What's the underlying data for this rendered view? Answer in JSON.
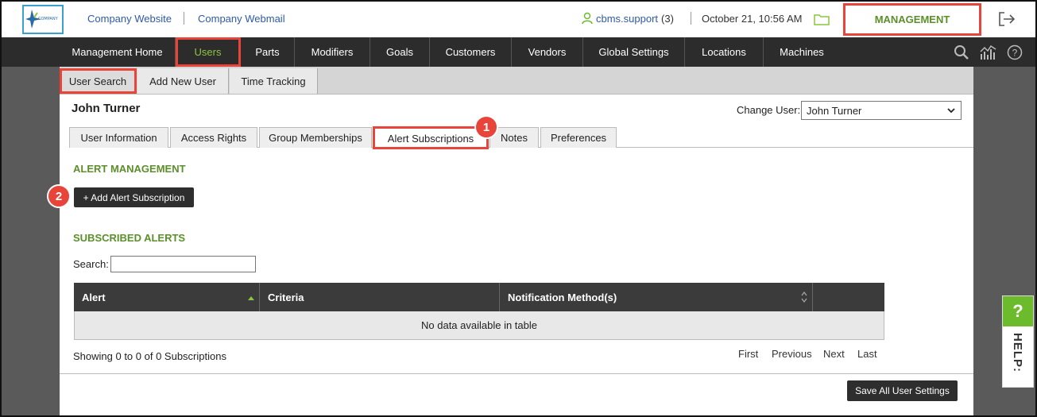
{
  "header": {
    "logo_text": "COMPANY",
    "links": [
      "Company Website",
      "Company Webmail"
    ],
    "user": "cbms.support",
    "user_count": "(3)",
    "datetime": "October 21, 10:56 AM",
    "management": "MANAGEMENT"
  },
  "nav": {
    "items": [
      "Management Home",
      "Users",
      "Parts",
      "Modifiers",
      "Goals",
      "Customers",
      "Vendors",
      "Global Settings",
      "Locations",
      "Machines"
    ]
  },
  "subtabs": [
    "User Search",
    "Add New User",
    "Time Tracking"
  ],
  "main": {
    "user_name": "John Turner",
    "change_user_label": "Change User:",
    "change_user_value": "John Turner",
    "tabs": [
      "User Information",
      "Access Rights",
      "Group Memberships",
      "Alert Subscriptions",
      "Notes",
      "Preferences"
    ],
    "alert_management_title": "ALERT MANAGEMENT",
    "add_alert_label": "+ Add Alert Subscription",
    "subscribed_title": "SUBSCRIBED ALERTS",
    "search_label": "Search:",
    "search_value": "",
    "table_headers": [
      "Alert",
      "Criteria",
      "Notification Method(s)"
    ],
    "table_empty": "No data available in table",
    "showing": "Showing 0 to 0 of 0 Subscriptions",
    "pager": [
      "First",
      "Previous",
      "Next",
      "Last"
    ],
    "save_label": "Save All User Settings"
  },
  "callouts": [
    "1",
    "2"
  ],
  "help": {
    "q": "?",
    "label": "HELP:"
  },
  "colors": {
    "accent_green": "#5b8f2a",
    "nav_bg": "#2c2c2c",
    "highlight_red": "#e8443a",
    "help_green": "#6cbb2c"
  }
}
